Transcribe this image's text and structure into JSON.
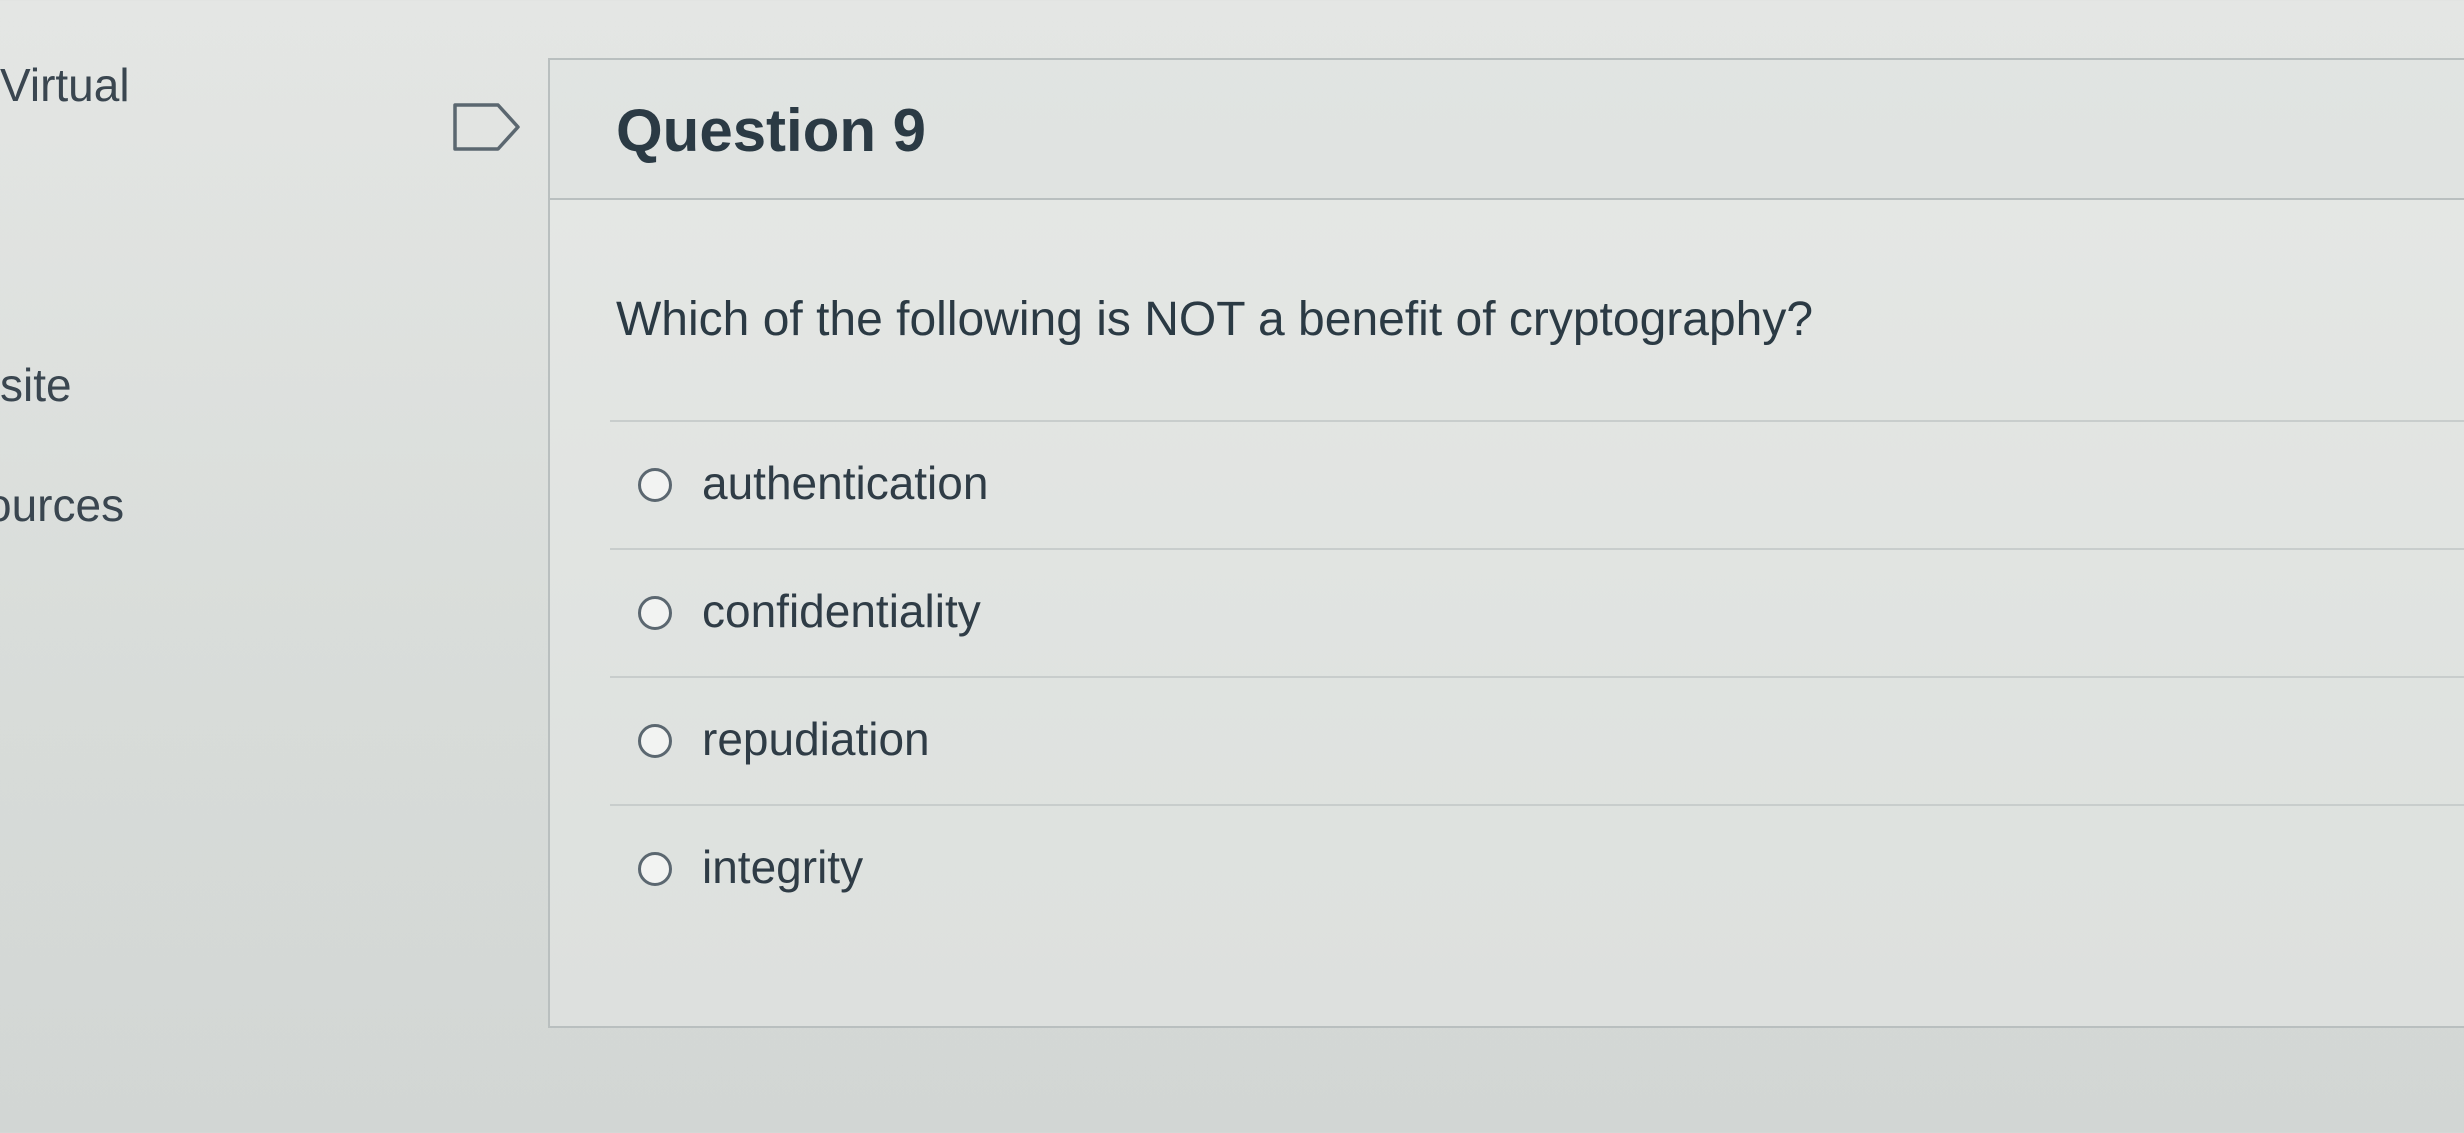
{
  "sidebar": {
    "items": [
      {
        "label": "Virtual"
      },
      {
        "label": "site"
      },
      {
        "label": "ources"
      }
    ]
  },
  "question": {
    "title": "Question 9",
    "text": "Which of the following is NOT a benefit of cryptography?",
    "options": [
      {
        "label": "authentication"
      },
      {
        "label": "confidentiality"
      },
      {
        "label": "repudiation"
      },
      {
        "label": "integrity"
      }
    ]
  }
}
